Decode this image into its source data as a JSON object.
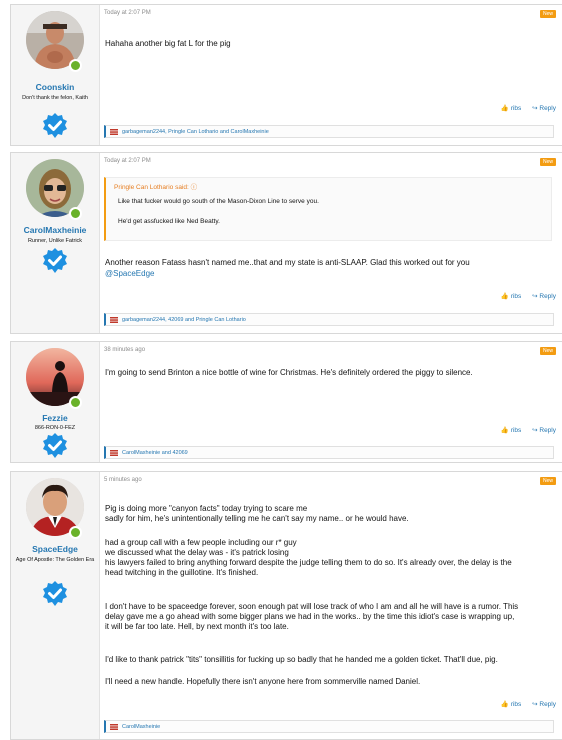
{
  "posts": [
    {
      "username": "Coonskin",
      "user_title": "Don't thank the felon, Kaith",
      "date": "Today at 2:07 PM",
      "badge": "New",
      "body": "Hahaha another big fat L for the pig",
      "actions": {
        "like": "ribs",
        "reply": "Reply"
      },
      "likes": "garbageman2244, Pringle Can Lothario and CarolMaxheinie"
    },
    {
      "username": "CarolMaxheinie",
      "user_title": "Runner, Unlike Fatrick",
      "date": "Today at 2:07 PM",
      "badge": "New",
      "quote": {
        "author": "Pringle Can Lothario said:",
        "lines": [
          "Like that fucker would go south of the Mason-Dixon Line to serve you.",
          "He'd get assfucked like Ned Beatty."
        ]
      },
      "body": "Another reason Fatass hasn't named me..that and my state is anti-SLAAP. Glad this worked out for you",
      "mention": "@SpaceEdge",
      "actions": {
        "like": "ribs",
        "reply": "Reply"
      },
      "likes": "garbageman2244, 42069 and Pringle Can Lothario"
    },
    {
      "username": "Fezzie",
      "user_title": "866-RON-0-FEZ",
      "date": "38 minutes ago",
      "badge": "New",
      "body": "I'm going to send Brinton a nice bottle of wine for Christmas. He's definitely ordered the piggy to silence.",
      "actions": {
        "like": "ribs",
        "reply": "Reply"
      },
      "likes": "CarolMaxheinie and 42069"
    },
    {
      "username": "SpaceEdge",
      "user_title": "Age Of Apostle: The Golden Era",
      "date": "5 minutes ago",
      "badge": "New",
      "paragraphs": [
        "Pig is doing more \"canyon facts\" today trying to scare me\nsadly for him, he's unintentionally telling me he can't say my name.. or he would have.",
        "had a group call with a few people including our r* guy\nwe discussed what the delay was - it's patrick losing\nhis lawyers failed to bring anything forward despite the judge telling them to do so. It's already over, the delay is the\nhead twitching in the guillotine. It's finished.",
        "I don't have to be spaceedge forever, soon enough pat will lose track of who I am and all he will have is a rumor. This\ndelay gave me a go ahead with some bigger plans we had in the works.. by the time this idiot's case is wrapping up,\nit will be far too late. Hell, by next month it's too late.",
        "I'd like to thank patrick \"tits\" tonsillitis for fucking up so badly that he handed me a golden ticket. That'll due, pig.",
        "I'll need a new handle. Hopefully there isn't anyone here from sommerville named Daniel."
      ],
      "actions": {
        "like": "ribs",
        "reply": "Reply"
      },
      "likes": "CarolMaxheinie"
    }
  ]
}
